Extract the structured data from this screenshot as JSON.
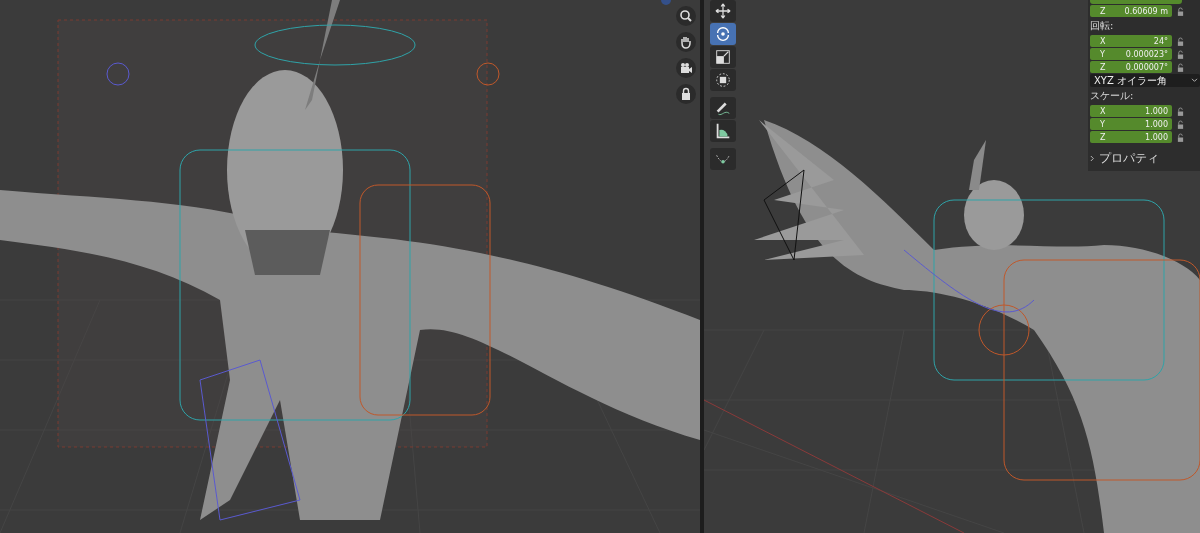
{
  "left_viewport": {
    "navigation": [
      {
        "kind": "zoom"
      },
      {
        "kind": "pan"
      },
      {
        "kind": "camera"
      },
      {
        "kind": "lock"
      }
    ]
  },
  "right_viewport": {
    "tools": [
      {
        "kind": "move",
        "selected": false
      },
      {
        "kind": "rotate",
        "selected": true
      },
      {
        "kind": "scale",
        "selected": false
      },
      {
        "kind": "transform",
        "selected": false
      },
      {
        "kind": "annotate",
        "selected": false
      },
      {
        "kind": "measure",
        "selected": false
      },
      {
        "kind": "curve",
        "selected": false
      }
    ],
    "transform_panel": {
      "location": [
        {
          "axis": "Z",
          "value": "0.60609 m"
        }
      ],
      "rotation_heading": "回転:",
      "rotation": [
        {
          "axis": "X",
          "value": "24°"
        },
        {
          "axis": "Y",
          "value": "0.000023°"
        },
        {
          "axis": "Z",
          "value": "0.000007°"
        }
      ],
      "rotation_mode": "XYZ オイラー角",
      "scale_heading": "スケール:",
      "scale": [
        {
          "axis": "X",
          "value": "1.000"
        },
        {
          "axis": "Y",
          "value": "1.000"
        },
        {
          "axis": "Z",
          "value": "1.000"
        }
      ],
      "properties": {
        "label": "プロパティ",
        "expanded": false
      }
    }
  }
}
